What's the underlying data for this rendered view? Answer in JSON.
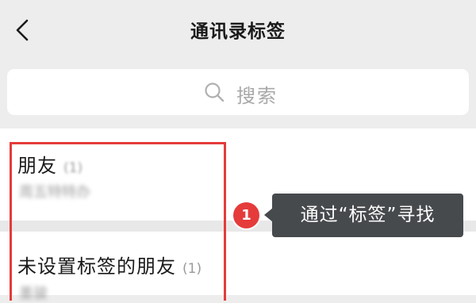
{
  "header": {
    "title": "通讯录标签",
    "back_icon": "chevron-left-icon"
  },
  "search": {
    "placeholder": "搜索",
    "icon": "search-icon"
  },
  "tags": [
    {
      "name": "朋友",
      "count": "(1)",
      "members": "周五特特办"
    },
    {
      "name": "未设置标签的朋友",
      "count": "(1)",
      "members": "墨骏"
    }
  ],
  "annotation": {
    "step_number": "1",
    "text": "通过“标签”寻找",
    "color": "#e53b3b"
  },
  "colors": {
    "background": "#ededed",
    "card": "#ffffff",
    "highlight": "#e53b3b",
    "callout": "#474a4d"
  }
}
